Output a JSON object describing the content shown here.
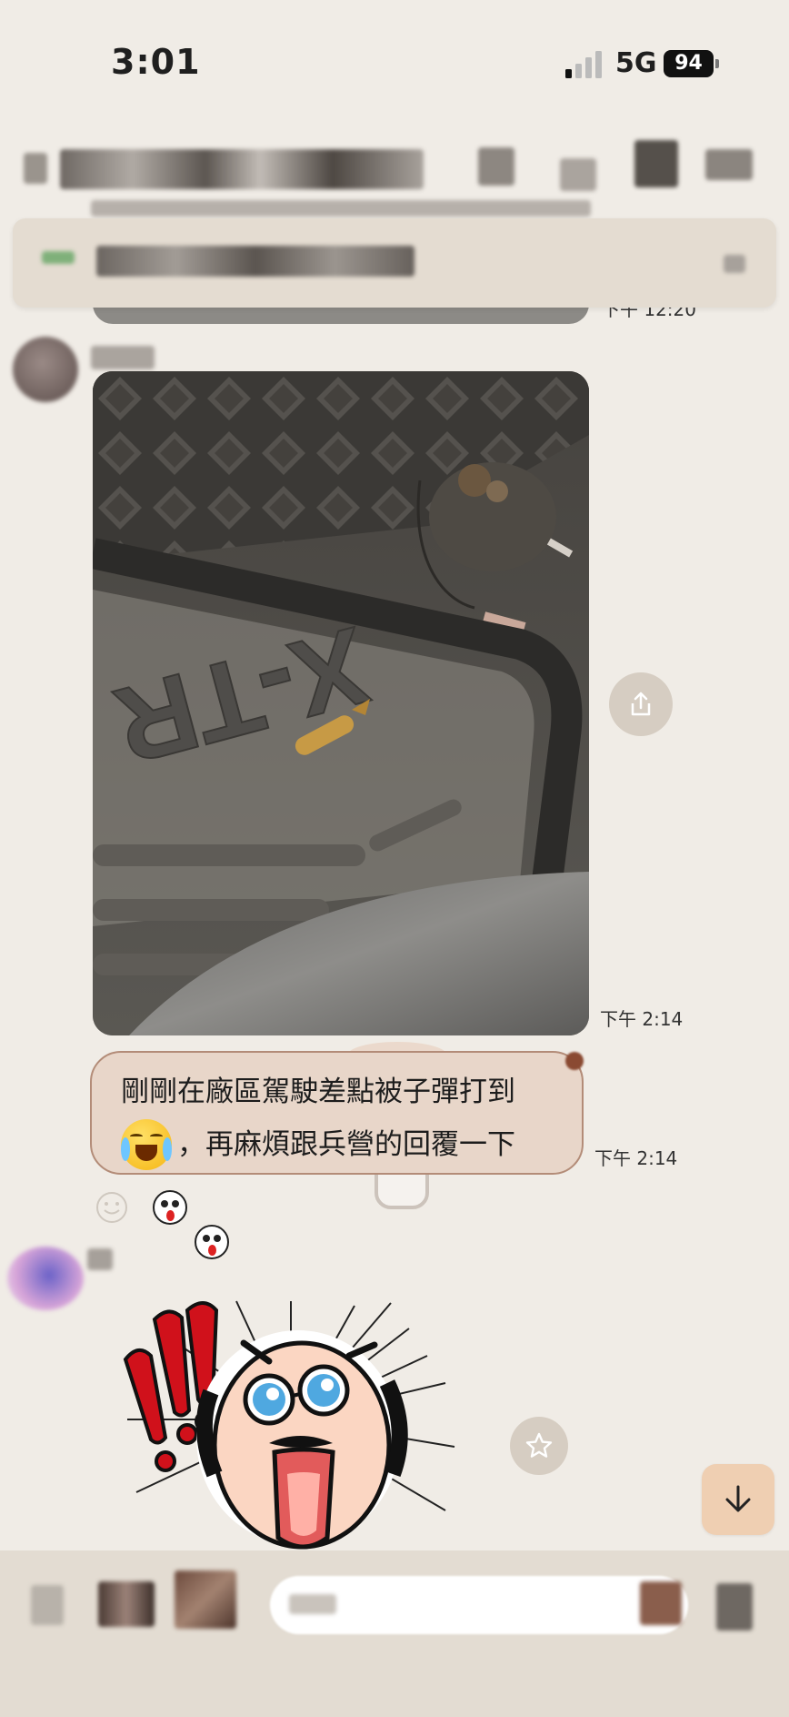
{
  "status_bar": {
    "time": "3:01",
    "network": "5G",
    "battery": "94"
  },
  "messages": {
    "image_message": {
      "timestamp": "下午 2:14",
      "mat_text": "X-TR"
    },
    "text_message": {
      "line1": "剛剛在廠區駕駛差點被子彈打到",
      "line2": "，再麻煩跟兵營的回覆一下",
      "timestamp": "下午 2:14"
    },
    "partial_timestamp": "下午 12:20"
  },
  "icons": {
    "share": "share-icon",
    "smile": "smile-icon",
    "star": "star-icon",
    "scroll_down": "arrow-down-icon"
  },
  "colors": {
    "background": "#f0ece6",
    "bubble": "#e8d6c9",
    "bubble_border": "#b38c78",
    "scroll_button": "#efcfb2"
  }
}
